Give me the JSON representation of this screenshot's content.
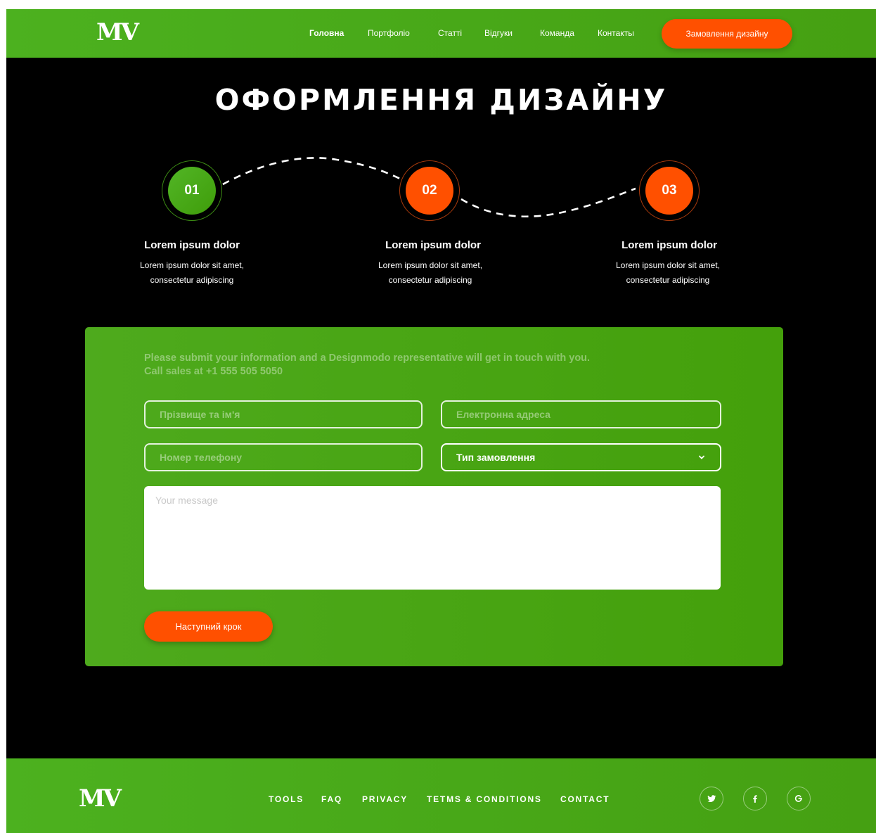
{
  "brand": {
    "logo_text": "MV"
  },
  "header": {
    "nav": [
      "Головна",
      "Портфоліо",
      "Статті",
      "Відгуки",
      "Команда",
      "Контакты"
    ],
    "cta_label": "Замовлення дизайну"
  },
  "page": {
    "title": "ОФОРМЛЕННЯ ДИЗАЙНУ"
  },
  "steps": [
    {
      "number": "01",
      "title": "Lorem ipsum dolor",
      "desc_line1": "Lorem ipsum dolor sit amet,",
      "desc_line2": "consectetur adipiscing"
    },
    {
      "number": "02",
      "title": "Lorem ipsum dolor",
      "desc_line1": "Lorem ipsum dolor sit amet,",
      "desc_line2": "consectetur adipiscing"
    },
    {
      "number": "03",
      "title": "Lorem ipsum dolor",
      "desc_line1": "Lorem ipsum dolor sit amet,",
      "desc_line2": "consectetur adipiscing"
    }
  ],
  "form": {
    "intro_line1": "Please submit your information and a Designmodo representative will get in touch with you.",
    "intro_line2": "Call sales at +1 555 505 5050",
    "name_placeholder": "Прізвище та ім'я",
    "email_placeholder": "Електронна адреса",
    "phone_placeholder": "Номер телефону",
    "order_type_value": "Тип замовлення",
    "message_placeholder": "Your message",
    "next_label": "Наступний крок"
  },
  "footer": {
    "links": [
      "TOOLS",
      "FAQ",
      "PRIVACY",
      "TETMS & CONDITIONS",
      "CONTACT"
    ],
    "social_icons": [
      "twitter-icon",
      "facebook-icon",
      "google-icon"
    ]
  },
  "colors": {
    "green": "#4cb11f",
    "orange": "#ff5000",
    "background": "#000000"
  }
}
